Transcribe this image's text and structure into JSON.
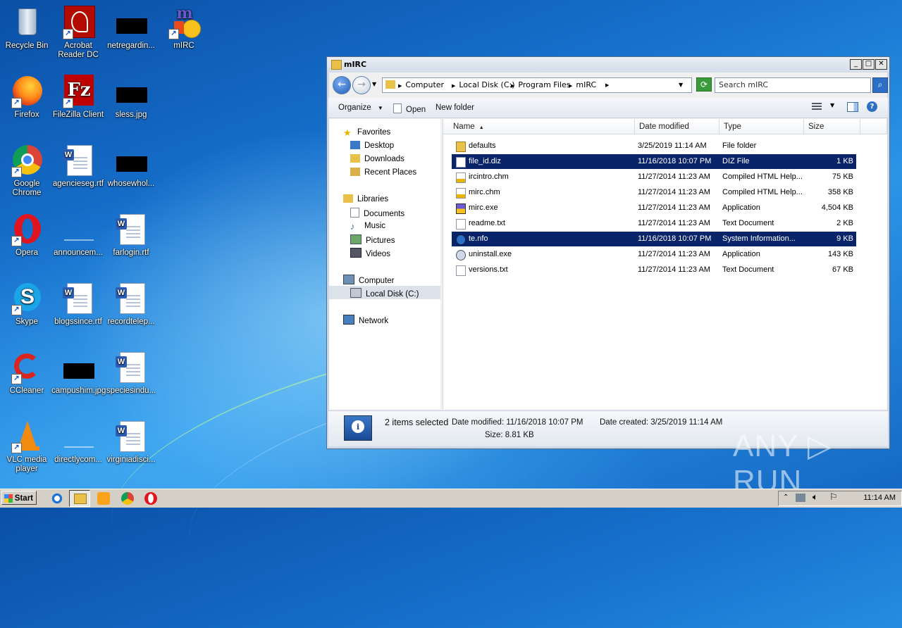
{
  "desktop": {
    "icons": [
      {
        "label": "Recycle Bin"
      },
      {
        "label": "Acrobat Reader DC"
      },
      {
        "label": "netregardin..."
      },
      {
        "label": "mIRC"
      },
      {
        "label": "Firefox"
      },
      {
        "label": "FileZilla Client"
      },
      {
        "label": "sless.jpg"
      },
      {
        "label": "Google Chrome"
      },
      {
        "label": "agencieseg.rtf"
      },
      {
        "label": "whosewhol..."
      },
      {
        "label": "Opera"
      },
      {
        "label": "announcem..."
      },
      {
        "label": "farlogin.rtf"
      },
      {
        "label": "Skype"
      },
      {
        "label": "blogssince.rtf"
      },
      {
        "label": "recordtelep..."
      },
      {
        "label": "CCleaner"
      },
      {
        "label": "campushim.jpg"
      },
      {
        "label": "speciesindu..."
      },
      {
        "label": "VLC media player"
      },
      {
        "label": "directlycom..."
      },
      {
        "label": "virginiadisci..."
      }
    ]
  },
  "window": {
    "title": "mIRC",
    "breadcrumb": [
      "Computer",
      "Local Disk (C:)",
      "Program Files",
      "mIRC"
    ],
    "search_placeholder": "Search mIRC",
    "toolbar": {
      "organize": "Organize",
      "open": "Open",
      "new_folder": "New folder"
    },
    "nav": {
      "favorites": "Favorites",
      "favorites_items": [
        "Desktop",
        "Downloads",
        "Recent Places"
      ],
      "libraries": "Libraries",
      "libraries_items": [
        "Documents",
        "Music",
        "Pictures",
        "Videos"
      ],
      "computer": "Computer",
      "computer_items": [
        "Local Disk (C:)"
      ],
      "network": "Network"
    },
    "columns": {
      "name": "Name",
      "date": "Date modified",
      "type": "Type",
      "size": "Size"
    },
    "files": [
      {
        "name": "defaults",
        "date": "3/25/2019 11:14 AM",
        "type": "File folder",
        "size": "",
        "selected": false,
        "icon": "folder-icon"
      },
      {
        "name": "file_id.diz",
        "date": "11/16/2018 10:07 PM",
        "type": "DIZ File",
        "size": "1 KB",
        "selected": true,
        "icon": "file-icon"
      },
      {
        "name": "ircintro.chm",
        "date": "11/27/2014 11:23 AM",
        "type": "Compiled HTML Help...",
        "size": "75 KB",
        "selected": false,
        "icon": "help-file-icon"
      },
      {
        "name": "mirc.chm",
        "date": "11/27/2014 11:23 AM",
        "type": "Compiled HTML Help...",
        "size": "358 KB",
        "selected": false,
        "icon": "help-file-icon"
      },
      {
        "name": "mirc.exe",
        "date": "11/27/2014 11:23 AM",
        "type": "Application",
        "size": "4,504 KB",
        "selected": false,
        "icon": "mirc-app-icon"
      },
      {
        "name": "readme.txt",
        "date": "11/27/2014 11:23 AM",
        "type": "Text Document",
        "size": "2 KB",
        "selected": false,
        "icon": "text-file-icon"
      },
      {
        "name": "te.nfo",
        "date": "11/16/2018 10:07 PM",
        "type": "System Information...",
        "size": "9 KB",
        "selected": true,
        "icon": "sysinfo-file-icon"
      },
      {
        "name": "uninstall.exe",
        "date": "11/27/2014 11:23 AM",
        "type": "Application",
        "size": "143 KB",
        "selected": false,
        "icon": "installer-icon"
      },
      {
        "name": "versions.txt",
        "date": "11/27/2014 11:23 AM",
        "type": "Text Document",
        "size": "67 KB",
        "selected": false,
        "icon": "text-file-icon"
      }
    ],
    "details": {
      "selected": "2 items selected",
      "date_modified": "Date modified: 11/16/2018 10:07 PM",
      "date_created": "Date created: 3/25/2019 11:14 AM",
      "size": "Size: 8.81 KB"
    }
  },
  "taskbar": {
    "start": "Start",
    "clock": "11:14 AM"
  },
  "watermark": "ANY ▷ RUN"
}
